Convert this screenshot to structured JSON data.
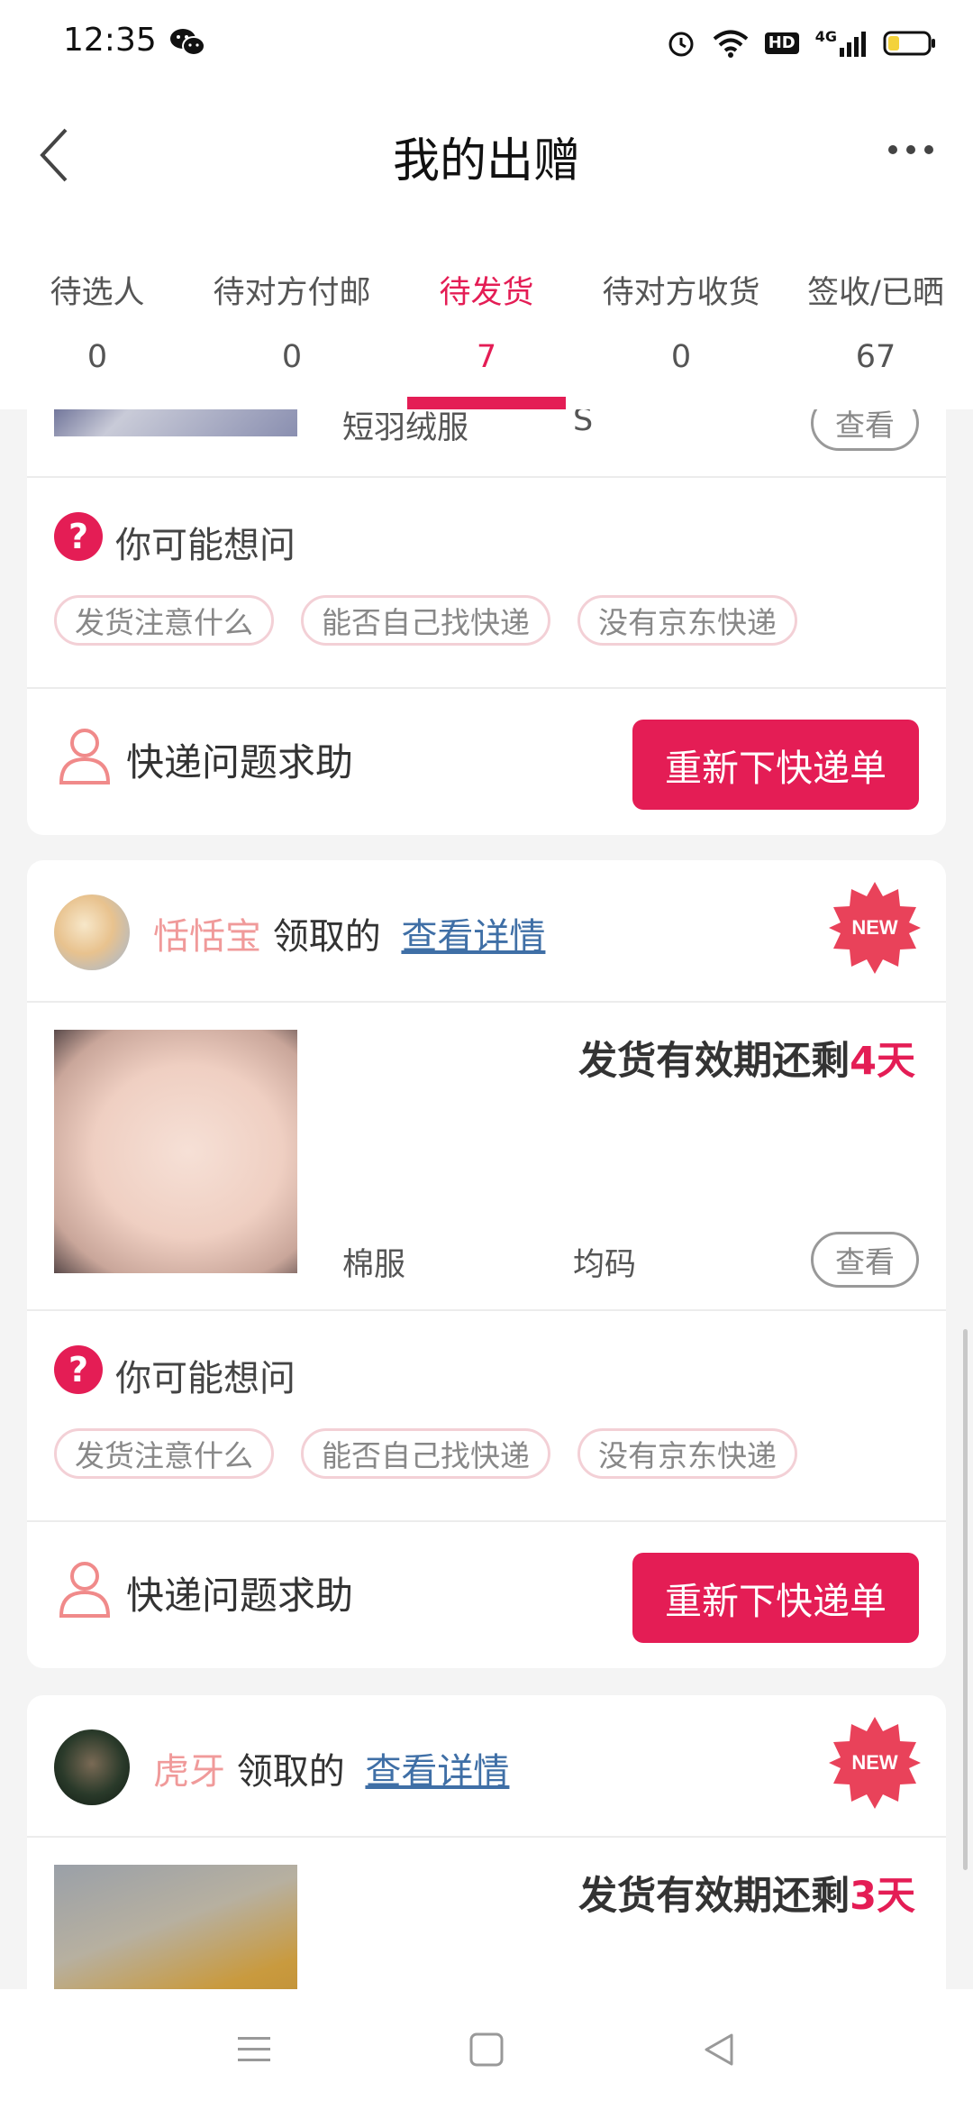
{
  "status_bar": {
    "time": "12:35",
    "hd_label": "HD",
    "network_label": "4G",
    "icons": [
      "wechat-icon",
      "alarm-icon",
      "wifi-icon",
      "hd-icon",
      "signal-icon",
      "battery-icon"
    ]
  },
  "nav": {
    "title": "我的出赠",
    "back_icon": "chevron-left-icon",
    "more_icon": "more-dots-icon"
  },
  "tabs": [
    {
      "label": "待选人",
      "count": "0"
    },
    {
      "label": "待对方付邮",
      "count": "0"
    },
    {
      "label": "待发货",
      "count": "7",
      "active": true
    },
    {
      "label": "待对方收货",
      "count": "0"
    },
    {
      "label": "签收/已晒",
      "count": "67"
    }
  ],
  "cards": [
    {
      "product_name": "短羽绒服",
      "product_size": "S",
      "view_label": "查看",
      "faq_title": "你可能想问",
      "faq_chips": [
        "发货注意什么",
        "能否自己找快递",
        "没有京东快递"
      ],
      "help_text": "快递问题求助",
      "reorder_label": "重新下快递单"
    },
    {
      "giver_name": "恬恬宝",
      "giver_suffix": "领取的",
      "detail_link": "查看详情",
      "badge": "NEW",
      "deadline_prefix": "发货有效期还剩",
      "deadline_days": "4天",
      "product_name": "棉服",
      "product_size": "均码",
      "view_label": "查看",
      "faq_title": "你可能想问",
      "faq_chips": [
        "发货注意什么",
        "能否自己找快递",
        "没有京东快递"
      ],
      "help_text": "快递问题求助",
      "reorder_label": "重新下快递单"
    },
    {
      "giver_name": "虎牙",
      "giver_suffix": "领取的",
      "detail_link": "查看详情",
      "badge": "NEW",
      "deadline_prefix": "发货有效期还剩",
      "deadline_days": "3天"
    }
  ],
  "colors": {
    "accent": "#e41d55",
    "link": "#3f6fa6",
    "name": "#f09a9a",
    "background": "#f4f4f4"
  }
}
